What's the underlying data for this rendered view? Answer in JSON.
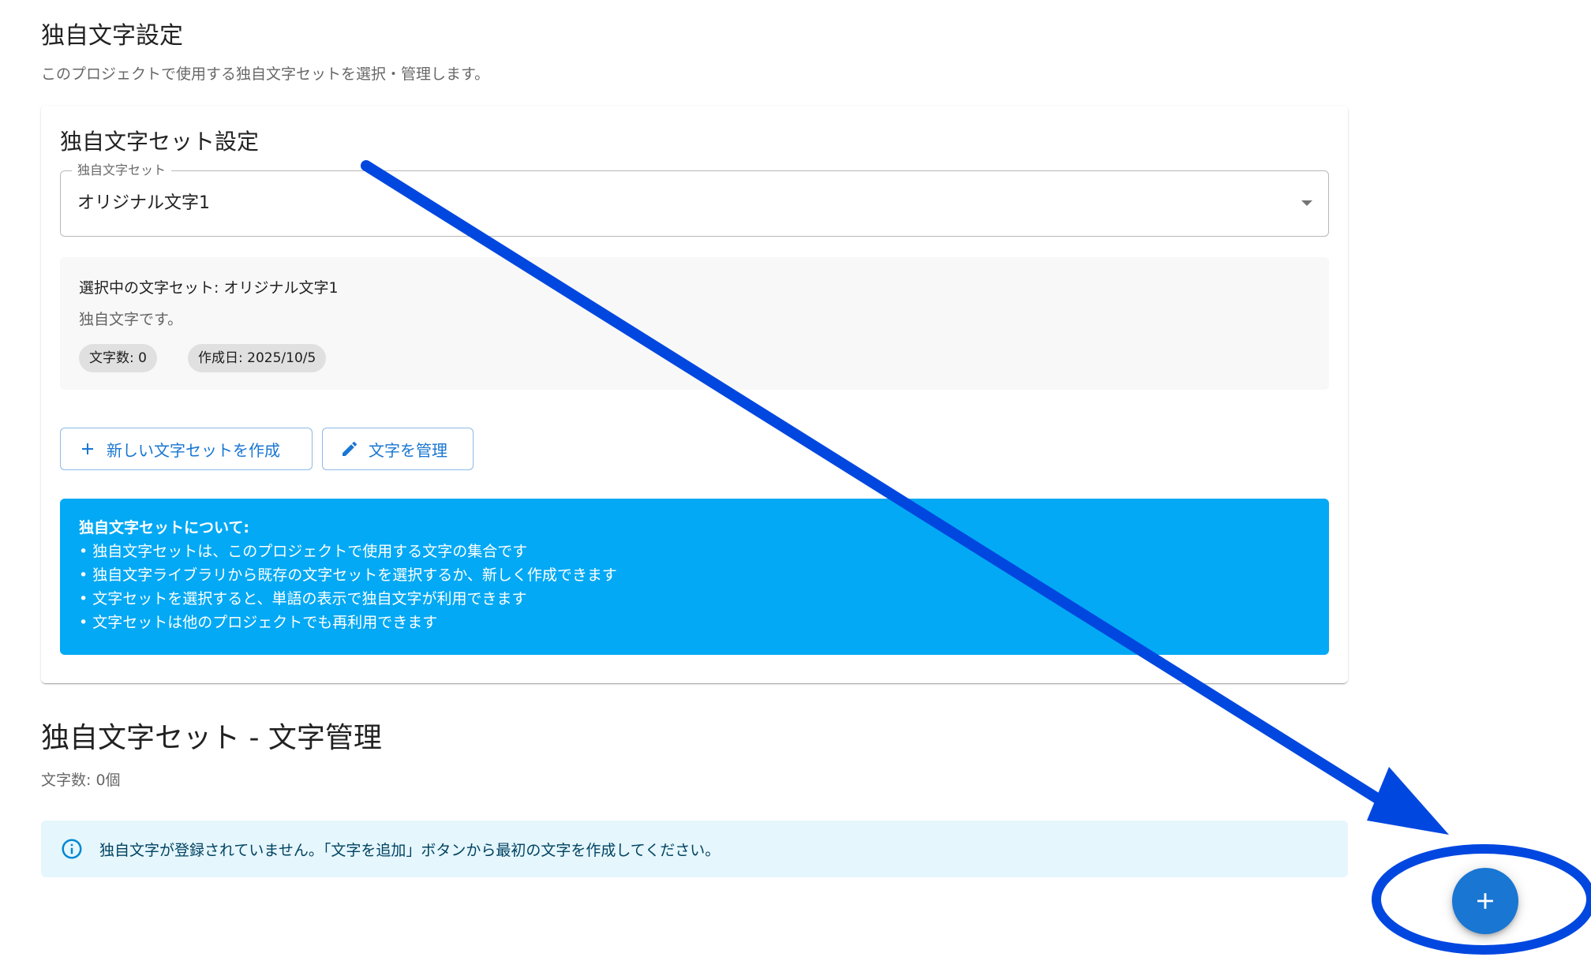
{
  "page": {
    "title": "独自文字設定",
    "subtitle": "このプロジェクトで使用する独自文字セットを選択・管理します。"
  },
  "settings_card": {
    "title": "独自文字セット設定",
    "select": {
      "label": "独自文字セット",
      "value": "オリジナル文字1"
    },
    "selected_info": {
      "name": "選択中の文字セット: オリジナル文字1",
      "description": "独自文字です。",
      "chips": {
        "count": "文字数: 0",
        "created": "作成日: 2025/10/5"
      }
    },
    "buttons": {
      "create_label": "新しい文字セットを作成",
      "manage_label": "文字を管理"
    },
    "about": {
      "title": "独自文字セットについて:",
      "lines": [
        "• 独自文字セットは、このプロジェクトで使用する文字の集合です",
        "• 独自文字ライブラリから既存の文字セットを選択するか、新しく作成できます",
        "• 文字セットを選択すると、単語の表示で独自文字が利用できます",
        "• 文字セットは他のプロジェクトでも再利用できます"
      ]
    }
  },
  "management": {
    "title": "独自文字セット - 文字管理",
    "count": "文字数: 0個",
    "empty_message": "独自文字が登録されていません。「文字を追加」ボタンから最初の文字を作成してください。"
  },
  "icons": {
    "create": "plus-icon",
    "manage": "pencil-icon",
    "alert": "info-icon",
    "fab": "plus-icon",
    "select": "chevron-down-icon"
  },
  "colors": {
    "primary": "#1976d2",
    "about_bg": "#03a9f4",
    "alert_bg": "#e5f6fd",
    "annotation": "#0047e0"
  }
}
